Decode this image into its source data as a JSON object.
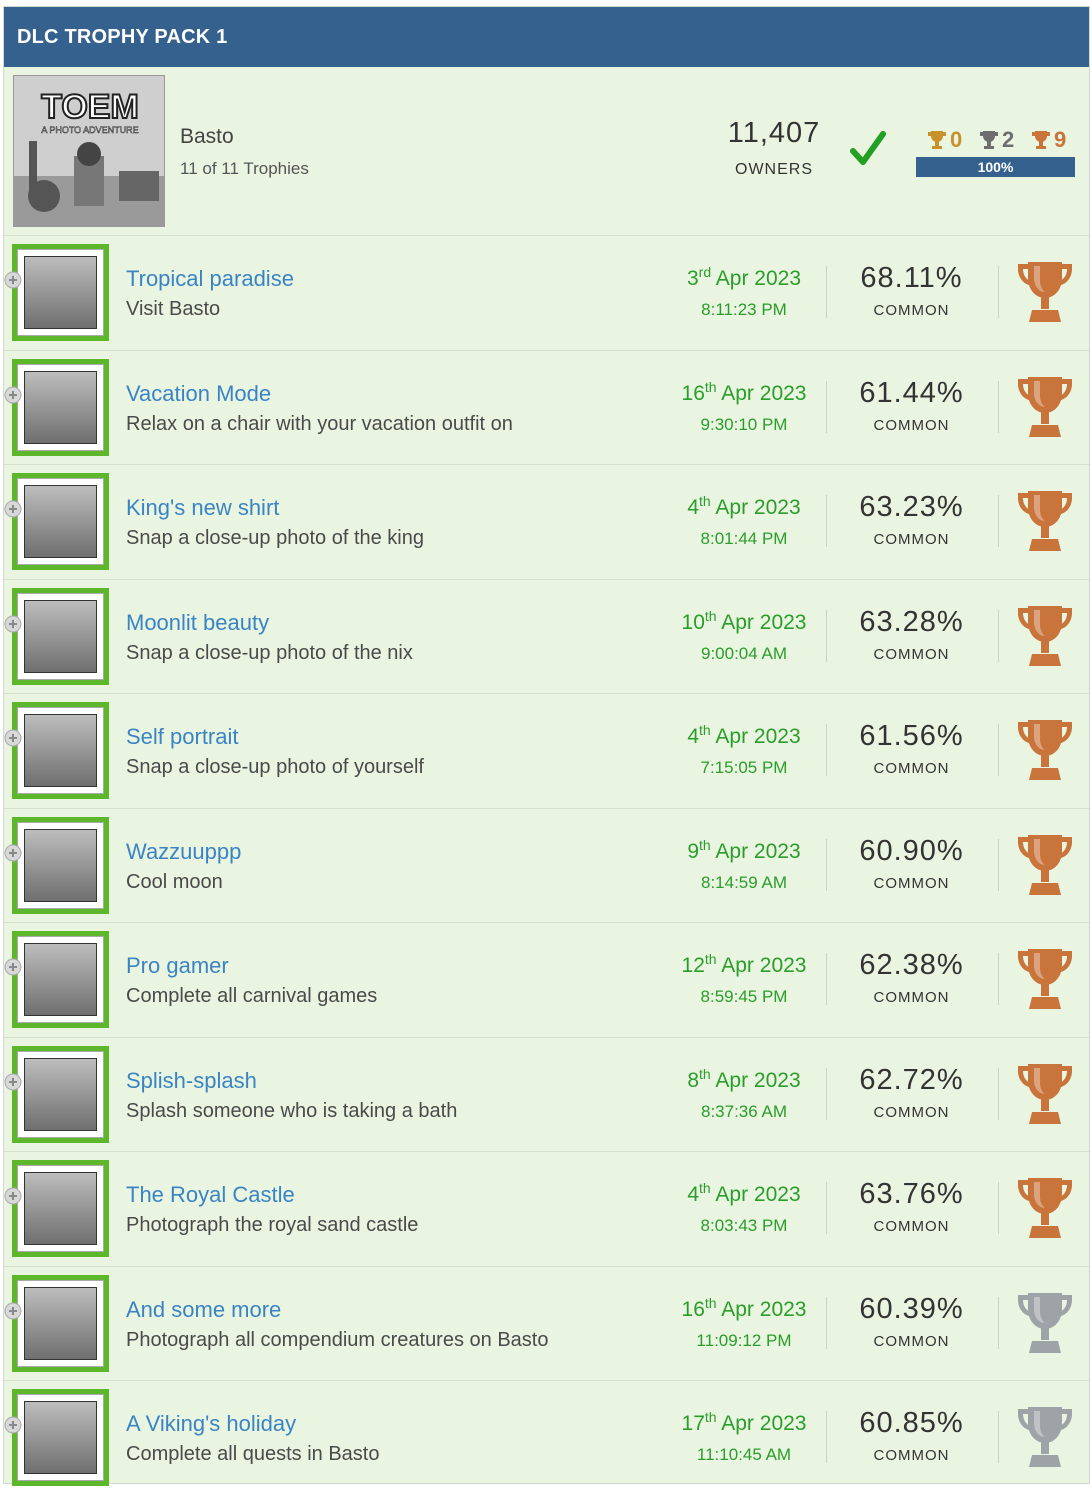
{
  "header": {
    "title": "DLC TROPHY PACK 1"
  },
  "game": {
    "art_logo": "TOEM",
    "art_subtitle": "A PHOTO ADVENTURE",
    "name": "Basto",
    "progress": "11 of 11 Trophies",
    "owners": "11,407",
    "owners_label": "OWNERS",
    "completed_icon": "check-icon",
    "counts": {
      "gold": "0",
      "silver": "2",
      "bronze": "9"
    },
    "completion_label": "100%",
    "completion_fraction": 1.0
  },
  "colors": {
    "header_bg": "#35618f",
    "accent_green": "#5cb82a",
    "date_green": "#2a9d2a",
    "title_blue": "#3a84c4",
    "bronze": "#c8743a",
    "silver": "#9ea3a8",
    "gold": "#c8922a"
  },
  "trophies": [
    {
      "title": "Tropical paradise",
      "desc": "Visit Basto",
      "day": "3",
      "suffix": "rd",
      "month_year": "Apr 2023",
      "time": "8:11:23 PM",
      "pct": "68.11%",
      "rarity": "COMMON",
      "type": "bronze"
    },
    {
      "title": "Vacation Mode",
      "desc": "Relax on a chair with your vacation outfit on",
      "day": "16",
      "suffix": "th",
      "month_year": "Apr 2023",
      "time": "9:30:10 PM",
      "pct": "61.44%",
      "rarity": "COMMON",
      "type": "bronze"
    },
    {
      "title": "King's new shirt",
      "desc": "Snap a close-up photo of the king",
      "day": "4",
      "suffix": "th",
      "month_year": "Apr 2023",
      "time": "8:01:44 PM",
      "pct": "63.23%",
      "rarity": "COMMON",
      "type": "bronze"
    },
    {
      "title": "Moonlit beauty",
      "desc": "Snap a close-up photo of the nix",
      "day": "10",
      "suffix": "th",
      "month_year": "Apr 2023",
      "time": "9:00:04 AM",
      "pct": "63.28%",
      "rarity": "COMMON",
      "type": "bronze"
    },
    {
      "title": "Self portrait",
      "desc": "Snap a close-up photo of yourself",
      "day": "4",
      "suffix": "th",
      "month_year": "Apr 2023",
      "time": "7:15:05 PM",
      "pct": "61.56%",
      "rarity": "COMMON",
      "type": "bronze"
    },
    {
      "title": "Wazzuuppp",
      "desc": "Cool moon",
      "day": "9",
      "suffix": "th",
      "month_year": "Apr 2023",
      "time": "8:14:59 AM",
      "pct": "60.90%",
      "rarity": "COMMON",
      "type": "bronze"
    },
    {
      "title": "Pro gamer",
      "desc": "Complete all carnival games",
      "day": "12",
      "suffix": "th",
      "month_year": "Apr 2023",
      "time": "8:59:45 PM",
      "pct": "62.38%",
      "rarity": "COMMON",
      "type": "bronze"
    },
    {
      "title": "Splish-splash",
      "desc": "Splash someone who is taking a bath",
      "day": "8",
      "suffix": "th",
      "month_year": "Apr 2023",
      "time": "8:37:36 AM",
      "pct": "62.72%",
      "rarity": "COMMON",
      "type": "bronze"
    },
    {
      "title": "The Royal Castle",
      "desc": "Photograph the royal sand castle",
      "day": "4",
      "suffix": "th",
      "month_year": "Apr 2023",
      "time": "8:03:43 PM",
      "pct": "63.76%",
      "rarity": "COMMON",
      "type": "bronze"
    },
    {
      "title": "And some more",
      "desc": "Photograph all compendium creatures on Basto",
      "day": "16",
      "suffix": "th",
      "month_year": "Apr 2023",
      "time": "11:09:12 PM",
      "pct": "60.39%",
      "rarity": "COMMON",
      "type": "silver"
    },
    {
      "title": "A Viking's holiday",
      "desc": "Complete all quests in Basto",
      "day": "17",
      "suffix": "th",
      "month_year": "Apr 2023",
      "time": "11:10:45 AM",
      "pct": "60.85%",
      "rarity": "COMMON",
      "type": "silver"
    }
  ]
}
